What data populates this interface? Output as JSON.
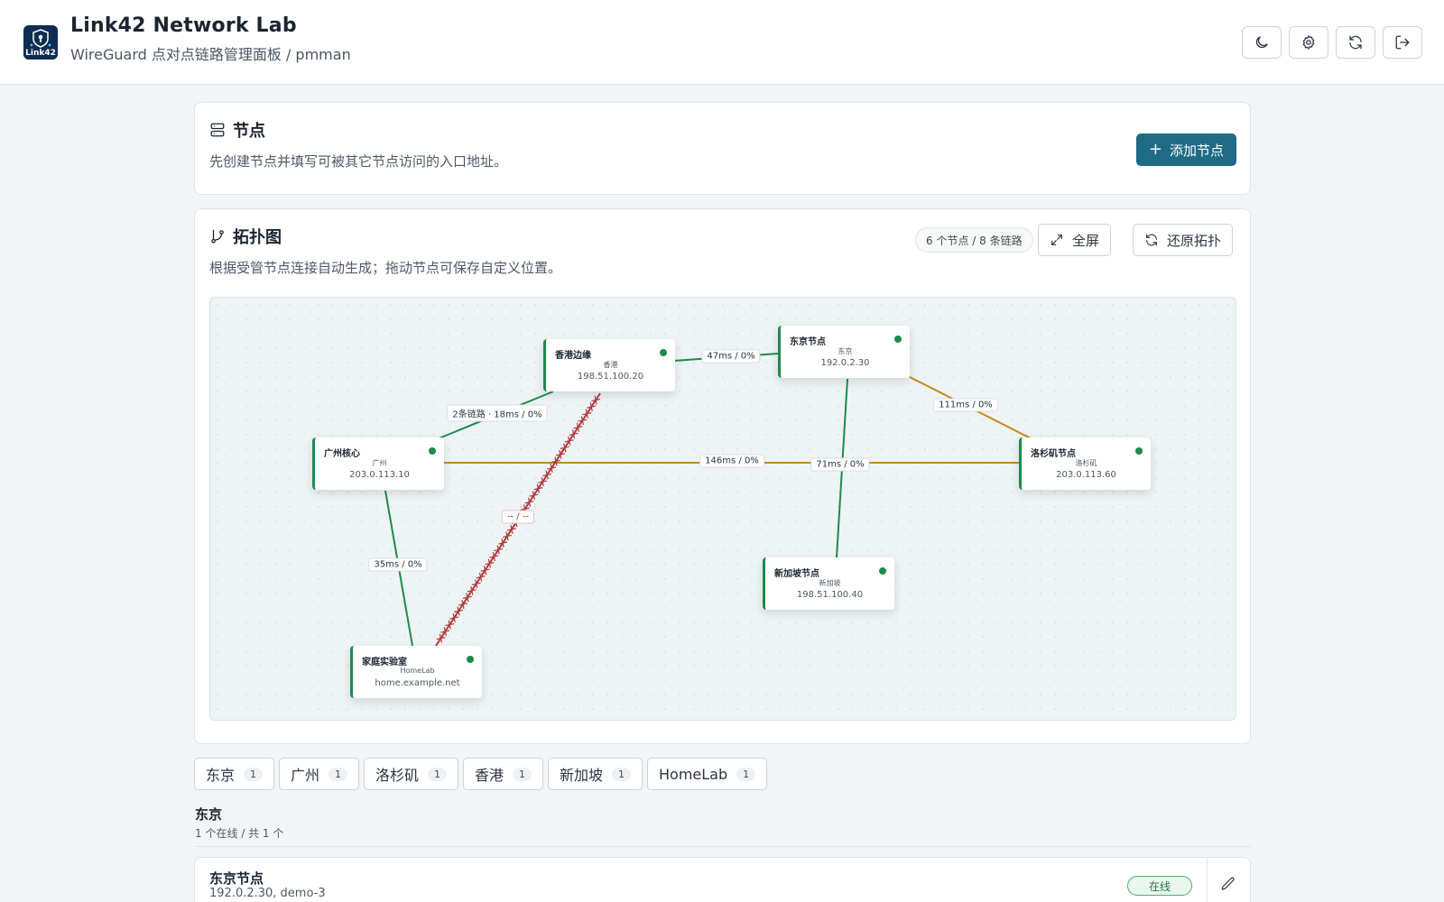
{
  "header": {
    "logo_text": "Link42",
    "title": "Link42 Network Lab",
    "subtitle": "WireGuard 点对点链路管理面板 / pmman",
    "actions": [
      {
        "icon": "moon-icon",
        "name": "theme-toggle-button"
      },
      {
        "icon": "gear-icon",
        "name": "settings-button"
      },
      {
        "icon": "refresh-icon",
        "name": "refresh-button"
      },
      {
        "icon": "logout-icon",
        "name": "logout-button"
      }
    ]
  },
  "nodes_section": {
    "title": "节点",
    "description": "先创建节点并填写可被其它节点访问的入口地址。",
    "add_button": "添加节点"
  },
  "topology": {
    "title": "拓扑图",
    "description": "根据受管节点连接自动生成；拖动节点可保存自定义位置。",
    "summary": "6 个节点 / 8 条链路",
    "fullscreen_button": "全屏",
    "reset_button": "还原拓扑",
    "nodes": [
      {
        "id": "hk",
        "name": "香港边缘",
        "region": "香港",
        "address": "198.51.100.20",
        "status": "online"
      },
      {
        "id": "tokyo",
        "name": "东京节点",
        "region": "东京",
        "address": "192.0.2.30",
        "status": "online"
      },
      {
        "id": "gz",
        "name": "广州核心",
        "region": "广州",
        "address": "203.0.113.10",
        "status": "online"
      },
      {
        "id": "la",
        "name": "洛杉矶节点",
        "region": "洛杉矶",
        "address": "203.0.113.60",
        "status": "online"
      },
      {
        "id": "sg",
        "name": "新加坡节点",
        "region": "新加坡",
        "address": "198.51.100.40",
        "status": "online"
      },
      {
        "id": "home",
        "name": "家庭实验室",
        "region": "HomeLab",
        "address": "home.example.net",
        "status": "online"
      }
    ],
    "links": [
      {
        "from": "hk",
        "to": "tokyo",
        "label": "47ms / 0%",
        "state": "good",
        "color": "#1e8a4c"
      },
      {
        "from": "gz",
        "to": "hk",
        "label": "2条链路 · 18ms / 0%",
        "state": "good",
        "color": "#1e8a4c"
      },
      {
        "from": "tokyo",
        "to": "la",
        "label": "111ms / 0%",
        "state": "warn",
        "color": "#c28a1e"
      },
      {
        "from": "gz",
        "to": "la",
        "label": "146ms / 0%",
        "state": "warn",
        "color": "#c28a1e"
      },
      {
        "from": "tokyo",
        "to": "sg",
        "label": "71ms / 0%",
        "state": "good",
        "color": "#1e8a4c"
      },
      {
        "from": "gz",
        "to": "home",
        "label": "35ms / 0%",
        "state": "good",
        "color": "#1e8a4c"
      },
      {
        "from": "hk",
        "to": "home",
        "label": "-- / --",
        "state": "down",
        "color": "#b03a3a"
      }
    ]
  },
  "region_filters": [
    {
      "label": "东京",
      "count": "1"
    },
    {
      "label": "广州",
      "count": "1"
    },
    {
      "label": "洛杉矶",
      "count": "1"
    },
    {
      "label": "香港",
      "count": "1"
    },
    {
      "label": "新加坡",
      "count": "1"
    },
    {
      "label": "HomeLab",
      "count": "1"
    }
  ],
  "group": {
    "title": "东京",
    "summary": "1 个在线 / 共 1 个"
  },
  "node_rows": [
    {
      "name": "东京节点",
      "address": "192.0.2.30, demo-3",
      "status": "在线"
    }
  ],
  "colors": {
    "primary": "#1f6a85",
    "online": "#1e8a4c",
    "warn": "#c28a1e",
    "down": "#b03a3a"
  }
}
